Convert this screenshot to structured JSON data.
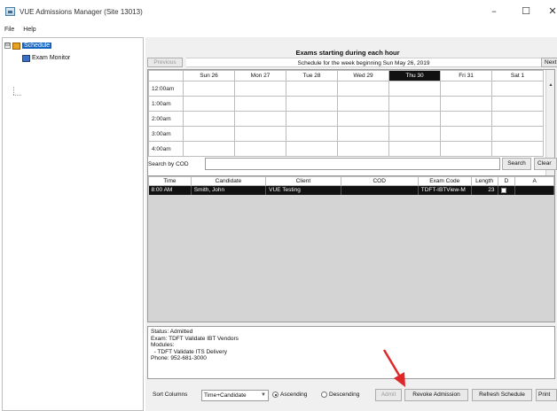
{
  "window": {
    "title": "VUE Admissions Manager (Site 13013)",
    "minimize_glyph": "–",
    "maximize_glyph": "☐",
    "close_glyph": "✕"
  },
  "menu": {
    "items": [
      "File",
      "Help"
    ]
  },
  "tree": {
    "root": {
      "label": "Schedule",
      "icon": "calendar-icon",
      "expander": "⊟"
    },
    "child": {
      "label": "Exam Monitor",
      "icon": "monitor-icon"
    }
  },
  "schedule": {
    "heading": "Exams starting during each hour",
    "week_label": "Schedule for the week beginning Sun May 26, 2019",
    "previous_label": "Previous",
    "next_label": "Next",
    "days": [
      "Sun 26",
      "Mon 27",
      "Tue 28",
      "Wed 29",
      "Thu 30",
      "Fri 31",
      "Sat 1"
    ],
    "selected_day": "Thu 30",
    "times": [
      "12:00am",
      "1:00am",
      "2:00am",
      "3:00am",
      "4:00am"
    ]
  },
  "search": {
    "label": "Search by COD",
    "value": "",
    "button_label": "Search",
    "clear_label": "Clear"
  },
  "exams_table": {
    "columns": [
      "Time",
      "Candidate",
      "Client",
      "COD",
      "Exam Code",
      "Length",
      "D",
      "A"
    ],
    "rows": [
      {
        "time": "8:00 AM",
        "candidate": "Smith, John",
        "client": "VUE Testing",
        "cod": "",
        "exam_code": "TDFT-IBTView-M",
        "length": "23",
        "d": "",
        "a": ""
      }
    ]
  },
  "details": {
    "lines": [
      "Status: Admitted",
      "Exam: TDFT Validate IBT Vendors",
      "Modules:",
      "  - TDFT Validate ITS Delivery",
      "Phone: 952-681-3000"
    ]
  },
  "footer": {
    "sort_label": "Sort Columns",
    "sort_value": "Time+Candidate",
    "ascending_label": "Ascending",
    "descending_label": "Descending",
    "admit_label": "Admit",
    "revoke_label": "Revoke Admission",
    "refresh_label": "Refresh Schedule",
    "print_label": "Print"
  },
  "colors": {
    "selection": "#1565c0",
    "selected_header": "#111111",
    "annotation_arrow": "#e0282a"
  }
}
